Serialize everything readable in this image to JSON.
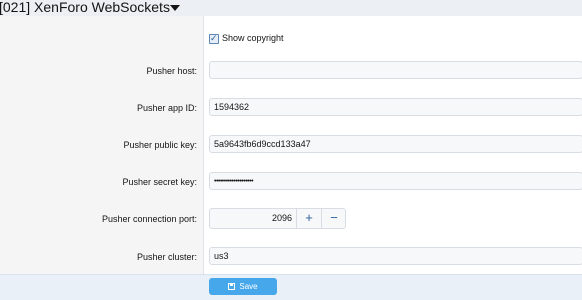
{
  "header": {
    "title": "[021] XenForo WebSockets"
  },
  "show_copyright": {
    "label": "Show copyright",
    "checked": true
  },
  "fields": {
    "pusher_host": {
      "label": "Pusher host:",
      "value": ""
    },
    "pusher_app_id": {
      "label": "Pusher app ID:",
      "value": "1594362"
    },
    "pusher_public_key": {
      "label": "Pusher public key:",
      "value": "5a9643fb6d9ccd133a47"
    },
    "pusher_secret_key": {
      "label": "Pusher secret key:",
      "value": "••••••••••••••••••••"
    },
    "pusher_connection_port": {
      "label": "Pusher connection port:",
      "value": "2096",
      "increment": "+",
      "decrement": "−"
    },
    "pusher_cluster": {
      "label": "Pusher cluster:",
      "value": "us3"
    }
  },
  "footer": {
    "save_label": "Save"
  },
  "colors": {
    "accent": "#47a7eb",
    "label_bg": "#f5f5f5",
    "footer_bg": "#eaf0f7"
  },
  "icons": {
    "title_caret": "caret-down-icon",
    "checkbox": "checkbox-checked-icon",
    "save": "save-icon"
  }
}
